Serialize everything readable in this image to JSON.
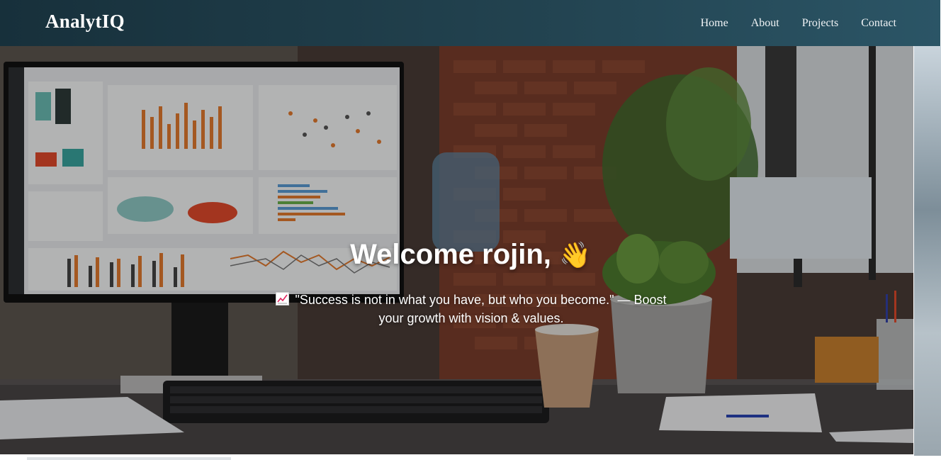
{
  "navbar": {
    "brand": "AnalytIQ",
    "links": [
      "Home",
      "About",
      "Projects",
      "Contact"
    ]
  },
  "hero": {
    "greeting": "Welcome rojin,",
    "greeting_emoji": "👋",
    "quote_icon": "chart-increasing-icon",
    "quote": "\"Success is not in what you have, but who you become.\" — Boost your growth with vision & values."
  },
  "colors": {
    "navbar_start": "#17303b",
    "navbar_end": "#2b5566",
    "accent_orange": "#e47a2e"
  }
}
